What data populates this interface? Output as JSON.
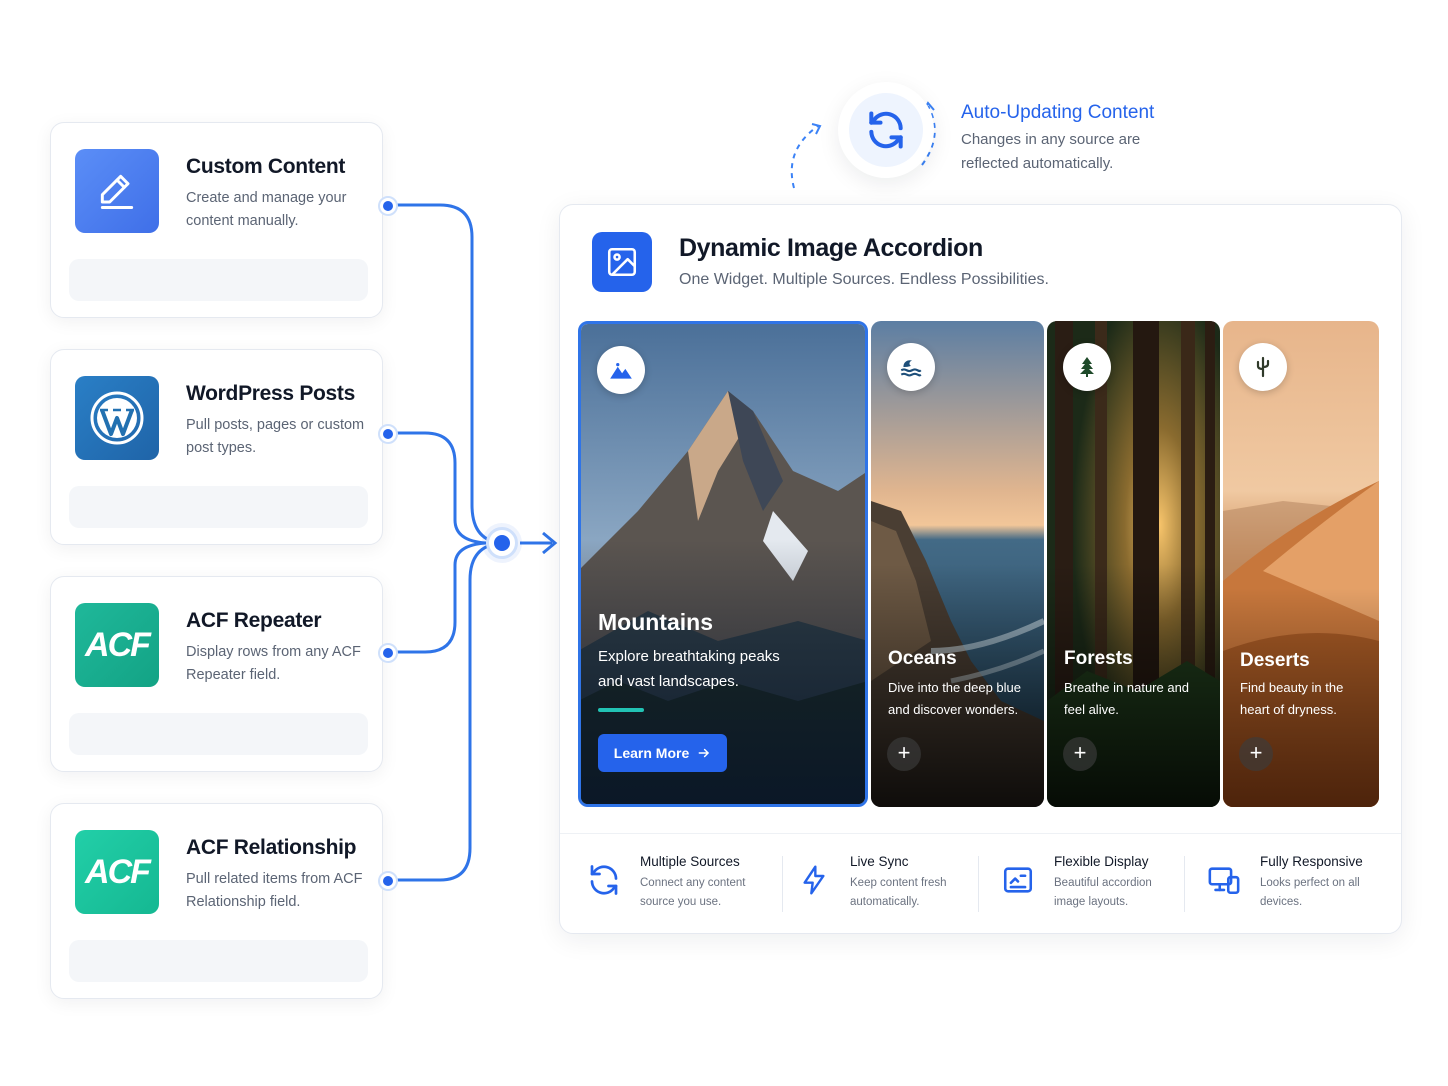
{
  "sources": [
    {
      "title": "Custom Content",
      "desc": "Create and manage your content manually.",
      "icon": "pencil-icon",
      "color": "#4f8af6"
    },
    {
      "title": "WordPress Posts",
      "desc": "Pull posts, pages or custom post types.",
      "icon": "wordpress-icon",
      "color": "#2271b1"
    },
    {
      "title": "ACF Repeater",
      "desc": "Display rows from any ACF Repeater field.",
      "icon": "acf-icon",
      "logo_text": "ACF",
      "color": "#1fb394"
    },
    {
      "title": "ACF Relationship",
      "desc": "Pull related items from ACF Relationship field.",
      "icon": "acf-icon",
      "logo_text": "ACF",
      "color": "#21c49f"
    }
  ],
  "auto_update": {
    "title": "Auto-Updating Content",
    "desc": "Changes in any source are reflected automatically.",
    "icon": "refresh-icon"
  },
  "widget": {
    "title": "Dynamic Image Accordion",
    "subtitle": "One Widget. Multiple Sources. Endless Possibilities.",
    "icon": "image-icon",
    "panels": [
      {
        "title": "Mountains",
        "desc": "Explore breathtaking peaks and vast landscapes.",
        "icon": "mountain-icon",
        "button": "Learn More",
        "active": true
      },
      {
        "title": "Oceans",
        "desc": "Dive into the deep blue and discover wonders.",
        "icon": "wave-icon"
      },
      {
        "title": "Forests",
        "desc": "Breathe in nature and feel alive.",
        "icon": "tree-icon"
      },
      {
        "title": "Deserts",
        "desc": "Find beauty in the heart of dryness.",
        "icon": "cactus-icon"
      }
    ],
    "plus_label": "+",
    "features": [
      {
        "title": "Multiple Sources",
        "desc": "Connect any content source you use.",
        "icon": "sync-icon"
      },
      {
        "title": "Live Sync",
        "desc": "Keep content fresh automatically.",
        "icon": "bolt-icon"
      },
      {
        "title": "Flexible Display",
        "desc": "Beautiful accordion image layouts.",
        "icon": "layout-icon"
      },
      {
        "title": "Fully Responsive",
        "desc": "Looks perfect on all devices.",
        "icon": "devices-icon"
      }
    ]
  },
  "colors": {
    "accent": "#2563eb",
    "teal": "#22c3b4"
  }
}
